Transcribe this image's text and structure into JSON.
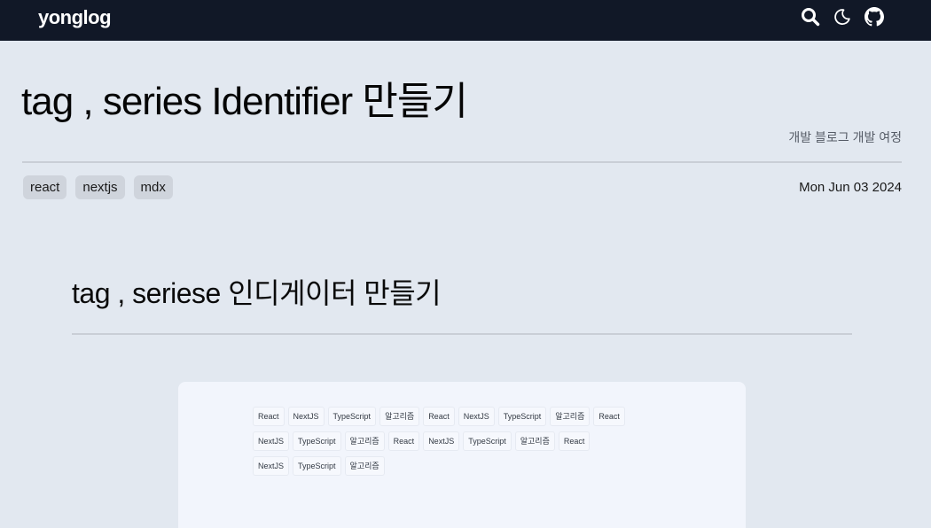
{
  "header": {
    "brand": "yonglog",
    "icons": [
      "search-icon",
      "moon-icon",
      "github-icon"
    ]
  },
  "post": {
    "title": "tag , series Identifier 만들기",
    "series": "개발 블로그 개발 여정",
    "tags": [
      "react",
      "nextjs",
      "mdx"
    ],
    "date": "Mon Jun 03 2024",
    "heading": "tag , seriese 인디게이터 만들기"
  },
  "preview": {
    "tags": [
      "React",
      "NextJS",
      "TypeScript",
      "알고리즘",
      "React",
      "NextJS",
      "TypeScript",
      "알고리즘",
      "React",
      "NextJS",
      "TypeScript",
      "알고리즘",
      "React",
      "NextJS",
      "TypeScript",
      "알고리즘",
      "React",
      "NextJS",
      "TypeScript",
      "알고리즘"
    ]
  },
  "colors": {
    "header_bg": "#111827",
    "page_bg": "#e2e8f0",
    "tag_bg": "#cfd4dc",
    "preview_bg": "#f2f5fc"
  }
}
